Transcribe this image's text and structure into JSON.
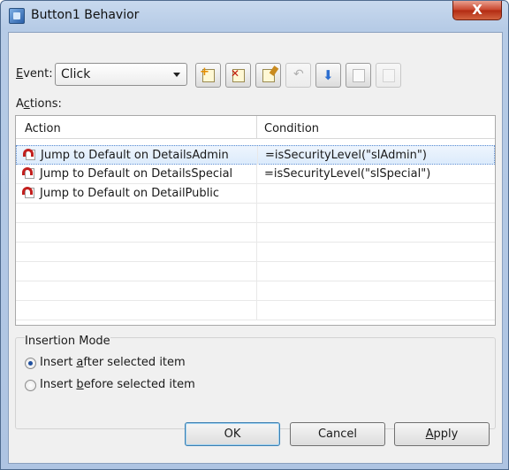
{
  "window": {
    "title": "Button1 Behavior",
    "close_glyph": "X"
  },
  "event": {
    "label": "Event:",
    "label_underline": "E",
    "label_rest": "vent:",
    "selected": "Click"
  },
  "toolbar": {
    "buttons": [
      {
        "name": "add-action",
        "icon": "add-document-icon",
        "enabled": true
      },
      {
        "name": "delete-action",
        "icon": "delete-document-icon",
        "enabled": true
      },
      {
        "name": "edit-action",
        "icon": "edit-document-icon",
        "enabled": true
      },
      {
        "name": "move-up",
        "icon": "undo-arrow-icon",
        "enabled": false
      },
      {
        "name": "move-down",
        "icon": "down-arrow-icon",
        "enabled": true
      },
      {
        "name": "copy",
        "icon": "copy-icon",
        "enabled": true
      },
      {
        "name": "paste",
        "icon": "paste-icon",
        "enabled": false
      }
    ]
  },
  "actions": {
    "label_prefix": "A",
    "label_underline": "c",
    "label_rest": "tions:",
    "columns": [
      "Action",
      "Condition"
    ],
    "rows": [
      {
        "action": "Jump to Default on DetailsAdmin",
        "condition": "=isSecurityLevel(\"slAdmin\")",
        "selected": true
      },
      {
        "action": "Jump to Default on DetailsSpecial",
        "condition": "=isSecurityLevel(\"slSpecial\")",
        "selected": false
      },
      {
        "action": "Jump to Default on DetailPublic",
        "condition": "",
        "selected": false
      }
    ]
  },
  "insertion_mode": {
    "title": "Insertion Mode",
    "after": {
      "prefix": "Insert ",
      "underline": "a",
      "rest": "fter selected item",
      "checked": true
    },
    "before": {
      "prefix": "Insert ",
      "underline": "b",
      "rest": "efore selected item",
      "checked": false
    }
  },
  "buttons": {
    "ok": "OK",
    "cancel": "Cancel",
    "apply_underline": "A",
    "apply_rest": "pply"
  },
  "colors": {
    "selection": "#dcebfc",
    "title_bar": "#b6cbe6",
    "close_button": "#c7432a"
  }
}
